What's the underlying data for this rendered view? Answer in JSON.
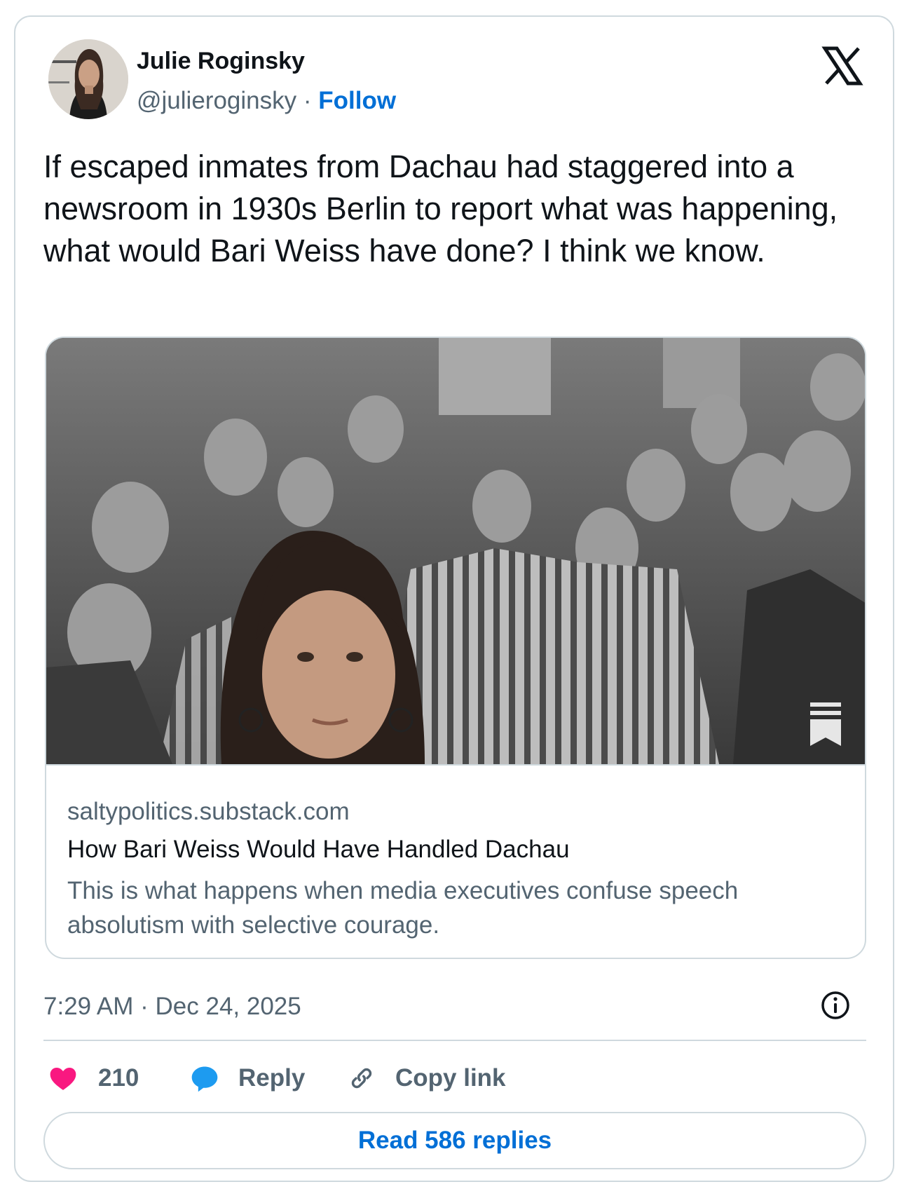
{
  "author": {
    "name": "Julie Roginsky",
    "handle": "@julieroginsky",
    "separator": " · ",
    "follow_label": "Follow"
  },
  "tweet": {
    "text": "If escaped inmates from Dachau had staggered into a newsroom in 1930s Berlin to report what was happening, what would Bari Weiss have done? I think we know."
  },
  "link_card": {
    "domain": "saltypolitics.substack.com",
    "title": "How Bari Weiss Would Have Handled Dachau",
    "description": "This is what happens when media executives confuse speech absolutism with selective courage."
  },
  "timestamp": "7:29 AM · Dec 24, 2025",
  "actions": {
    "like_count": "210",
    "reply_label": "Reply",
    "copy_link_label": "Copy link"
  },
  "read_replies_label": "Read 586 replies",
  "colors": {
    "like": "#f91880",
    "reply": "#1d9bf0",
    "link": "#006fd6",
    "muted": "#536471",
    "border": "#cfd9de"
  },
  "icons": [
    "x-logo-icon",
    "info-icon",
    "heart-icon",
    "speech-bubble-icon",
    "link-icon",
    "bookmark-icon"
  ]
}
